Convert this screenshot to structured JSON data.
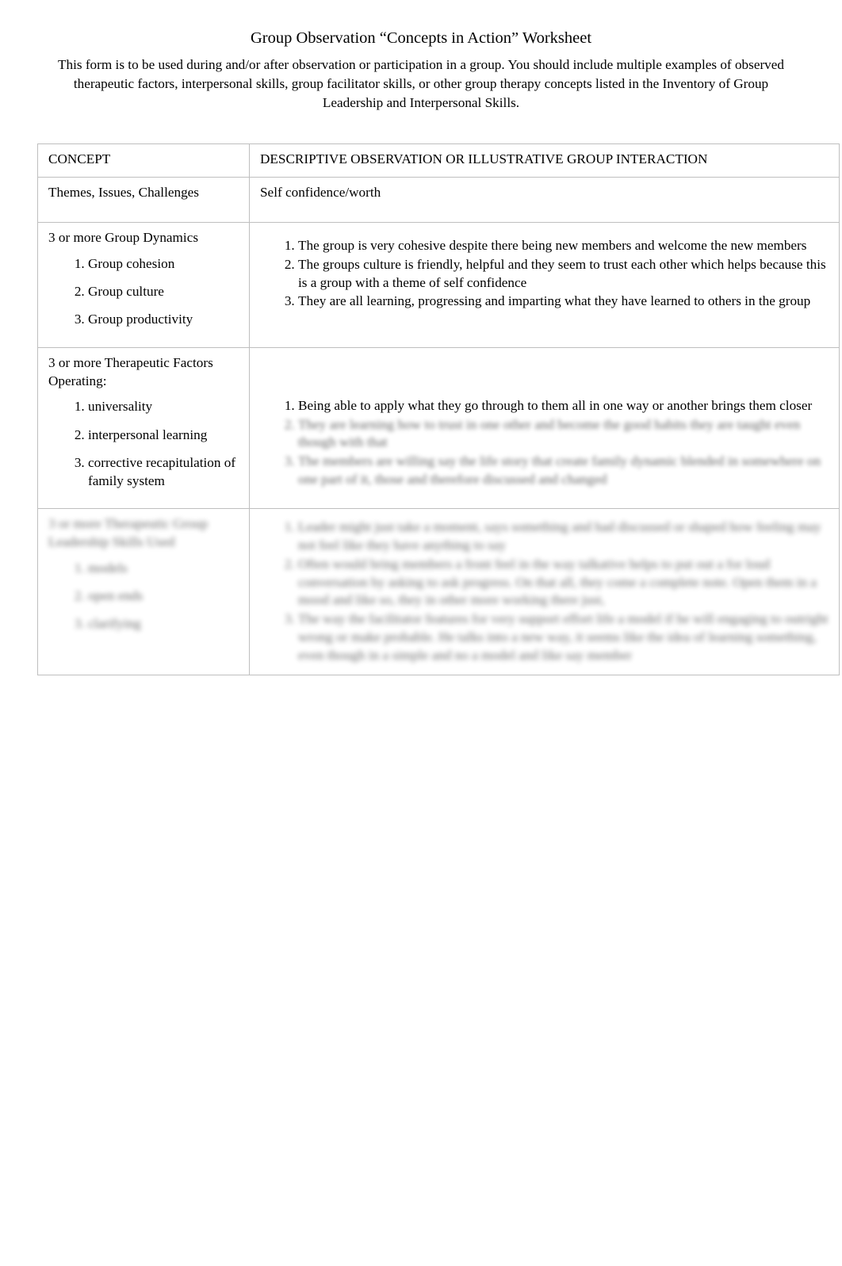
{
  "document": {
    "title": "Group Observation “Concepts in Action” Worksheet",
    "intro": "This form is to be used during and/or after observation or participation in a group. You should include multiple examples of observed therapeutic factors, interpersonal skills, group facilitator skills, or other group therapy concepts listed in the Inventory of Group Leadership and Interpersonal Skills."
  },
  "table": {
    "headers": {
      "concept": "CONCEPT",
      "description": "DESCRIPTIVE OBSERVATION OR ILLUSTRATIVE GROUP INTERACTION"
    },
    "rows": [
      {
        "concept_title": "Themes, Issues, Challenges",
        "concept_items": [],
        "description_items": [],
        "description_text": "Self confidence/worth"
      },
      {
        "concept_title": "3 or more Group Dynamics",
        "concept_items": [
          "Group cohesion",
          "Group culture",
          "Group productivity"
        ],
        "description_items": [
          "The group is very cohesive despite there being new members and welcome the new members",
          "The groups culture is friendly, helpful and they seem to trust each other which helps because this is a group with a theme of self confidence",
          "They are all learning, progressing and imparting what they have learned to others in the group"
        ],
        "description_text": ""
      },
      {
        "concept_title": "3 or more Therapeutic Factors Operating:",
        "concept_items": [
          "universality",
          "interpersonal learning",
          "corrective recapitulation of family system"
        ],
        "description_items": [
          "Being able to apply what they go through to them all in one way or another brings them closer",
          "They are learning how to trust in one other and become the good habits they are taught even though with that",
          "The members are willing say the life story that create family dynamic blended in somewhere on one part of it, those and therefore discussed and changed"
        ],
        "description_text": ""
      },
      {
        "concept_title": "3 or more Therapeutic Group Leadership Skills Used",
        "concept_items": [
          "models",
          "open ends",
          "clarifying"
        ],
        "description_items": [
          "Leader might just take a moment, says something and had discussed or shaped how feeling may not feel like they have anything to say",
          "Often would bring members a front feel in the way talkative helps to put out a for loud conversation by asking to ask progress. On that all, they come a complete note. Open them in a mood and like so, they in other more working there just,",
          "The way the facilitator features for very support effort life a model if he will engaging to outright wrong or make probable. He talks into a new way, it seems like the idea of learning something, even though in a simple and no a model and like say member"
        ],
        "description_text": ""
      }
    ]
  }
}
